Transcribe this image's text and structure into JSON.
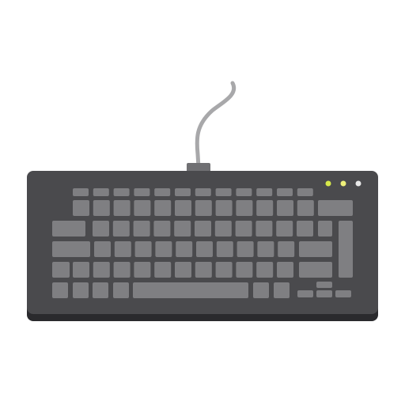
{
  "colors": {
    "background": "#ffffff",
    "body": "#4a4a4d",
    "body_shadow": "#2a2a2d",
    "key": "#7f7f82",
    "cable": "#a8a8aa",
    "cable_connector": "#707073",
    "led_1": "#d6e84a",
    "led_2": "#eef07a",
    "led_3": "#e8e8e8"
  },
  "icons": {
    "device": "keyboard-icon",
    "cable": "usb-cable-icon"
  },
  "indicator_lights": [
    {
      "name": "led-1",
      "color": "#d6e84a"
    },
    {
      "name": "led-2",
      "color": "#eef07a"
    },
    {
      "name": "led-3",
      "color": "#e8e8e8"
    }
  ]
}
